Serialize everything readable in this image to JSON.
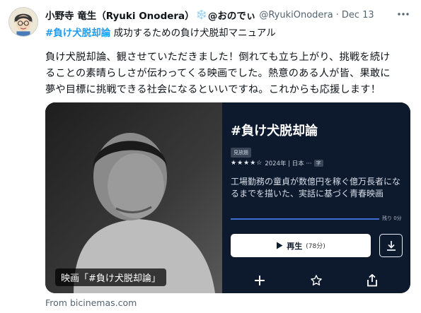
{
  "tweet": {
    "display_name": "小野寺 竜生（Ryuki Onodera）",
    "snow_emoji": "❄️",
    "handle_jp": "@おのでぃ",
    "handle": "@RyukiOnodera",
    "separator": "·",
    "date": "Dec 13",
    "hashtag": "#負け犬脱却論",
    "line1_rest": " 成功するための負け犬脱却マニュアル",
    "body_lines": [
      " 負け犬脱却論、観させていただきました！倒れても立ち上がり、挑戦を続け",
      "ることの素晴らしさが伝わってくる映画でした。熱意のある人が皆、果敢に",
      "夢や目標に挑戦できる社会になるといいですね。これからも応援します！"
    ],
    "more_icon": "more-horizontal-icon"
  },
  "card": {
    "caption": "映画「#負け犬脱却論」",
    "title": "#負け犬脱却論",
    "badge": "見放題",
    "stars": "★★★★☆",
    "meta": "2024年 | 日本 ···",
    "subtitle_badge": "字",
    "description": "工場勤務の童貞が数億円を稼ぐ億万長者になるまでを描いた、実話に基づく青春映画",
    "progress_fraction": 1.0,
    "remaining": "残り 0分",
    "play_label": "再生",
    "play_duration": "(78分)",
    "icons": {
      "play": "play-icon",
      "download": "download-icon",
      "add": "plus-icon",
      "favorite": "star-icon",
      "share": "share-icon"
    },
    "colors": {
      "panel_bg": "#0d1a2e",
      "progress": "#3c6fd6"
    }
  },
  "source": "From bicinemas.com",
  "colors": {
    "link": "#1d9bf0",
    "muted": "#536471"
  }
}
